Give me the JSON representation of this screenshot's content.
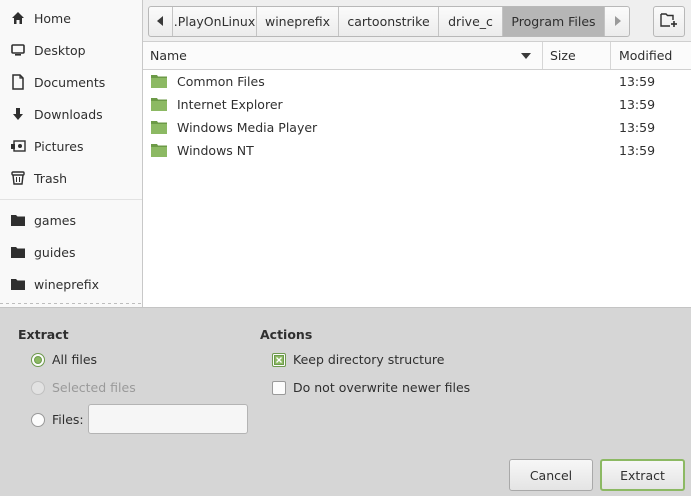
{
  "sidebar": {
    "items": [
      {
        "label": "Home",
        "icon": "home-icon"
      },
      {
        "label": "Desktop",
        "icon": "desktop-icon"
      },
      {
        "label": "Documents",
        "icon": "documents-icon"
      },
      {
        "label": "Downloads",
        "icon": "downloads-icon"
      },
      {
        "label": "Pictures",
        "icon": "pictures-icon"
      },
      {
        "label": "Trash",
        "icon": "trash-icon"
      }
    ],
    "bookmarks": [
      {
        "label": "games",
        "icon": "folder-icon"
      },
      {
        "label": "guides",
        "icon": "folder-icon"
      },
      {
        "label": "wineprefix",
        "icon": "folder-icon"
      }
    ]
  },
  "pathbar": {
    "segments": [
      ".PlayOnLinux",
      "wineprefix",
      "cartoonstrike",
      "drive_c",
      "Program Files"
    ],
    "active_segment": "Program Files"
  },
  "filelist": {
    "columns": {
      "name": "Name",
      "size": "Size",
      "modified": "Modified"
    },
    "rows": [
      {
        "name": "Common Files",
        "size": "",
        "modified": "13:59"
      },
      {
        "name": "Internet Explorer",
        "size": "",
        "modified": "13:59"
      },
      {
        "name": "Windows Media Player",
        "size": "",
        "modified": "13:59"
      },
      {
        "name": "Windows NT",
        "size": "",
        "modified": "13:59"
      }
    ]
  },
  "extract": {
    "title": "Extract",
    "all_files": "All files",
    "selected_files": "Selected files",
    "files": "Files:",
    "files_value": "",
    "selected_option": "All files"
  },
  "actions": {
    "title": "Actions",
    "keep_structure": "Keep directory structure",
    "keep_structure_checked": true,
    "no_overwrite": "Do not overwrite newer files",
    "no_overwrite_checked": false
  },
  "buttons": {
    "cancel": "Cancel",
    "extract": "Extract"
  },
  "colors": {
    "accent": "#8cb963",
    "folder": "#7fae55"
  }
}
